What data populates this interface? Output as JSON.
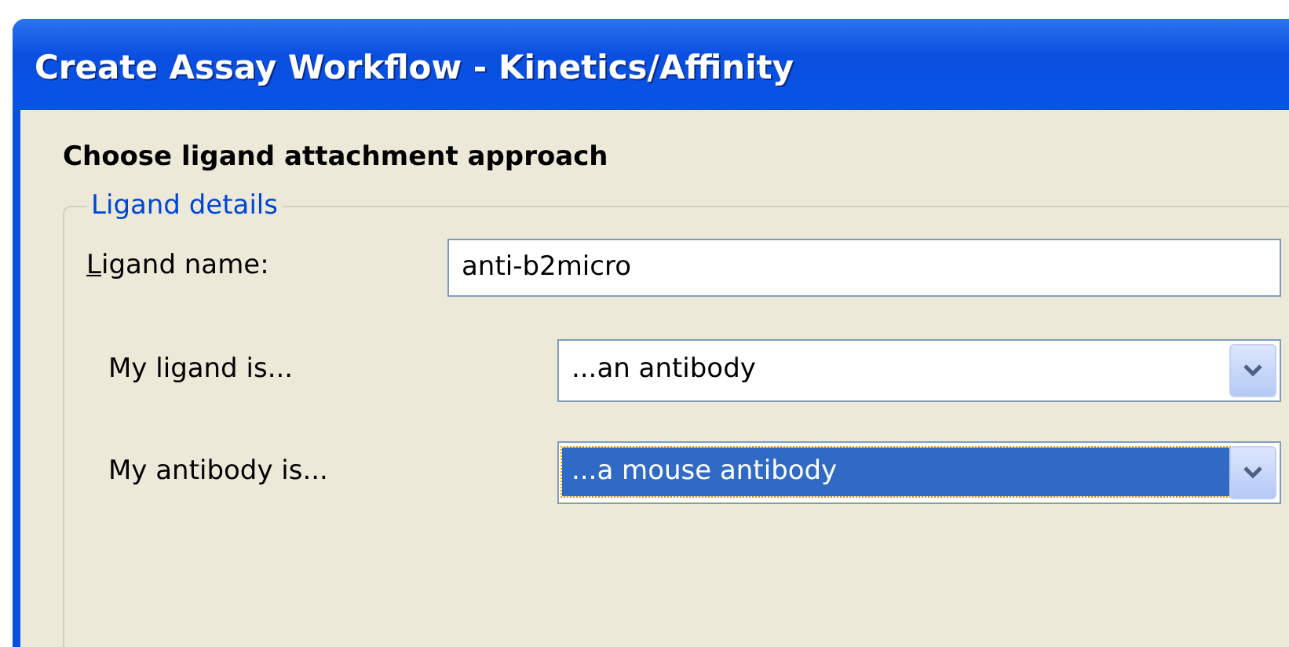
{
  "window": {
    "title": "Create Assay Workflow - Kinetics/Affinity"
  },
  "heading": "Choose ligand attachment approach",
  "group": {
    "legend": "Ligand details",
    "name_field": {
      "label": "Ligand name:",
      "mnemonic_underlined": true,
      "value": "anti-b2micro"
    },
    "dropdowns": [
      {
        "label": "My ligand is...",
        "value": "...an antibody",
        "focused": false
      },
      {
        "label": "My antibody is...",
        "value": "...a mouse antibody",
        "focused": true
      }
    ]
  }
}
